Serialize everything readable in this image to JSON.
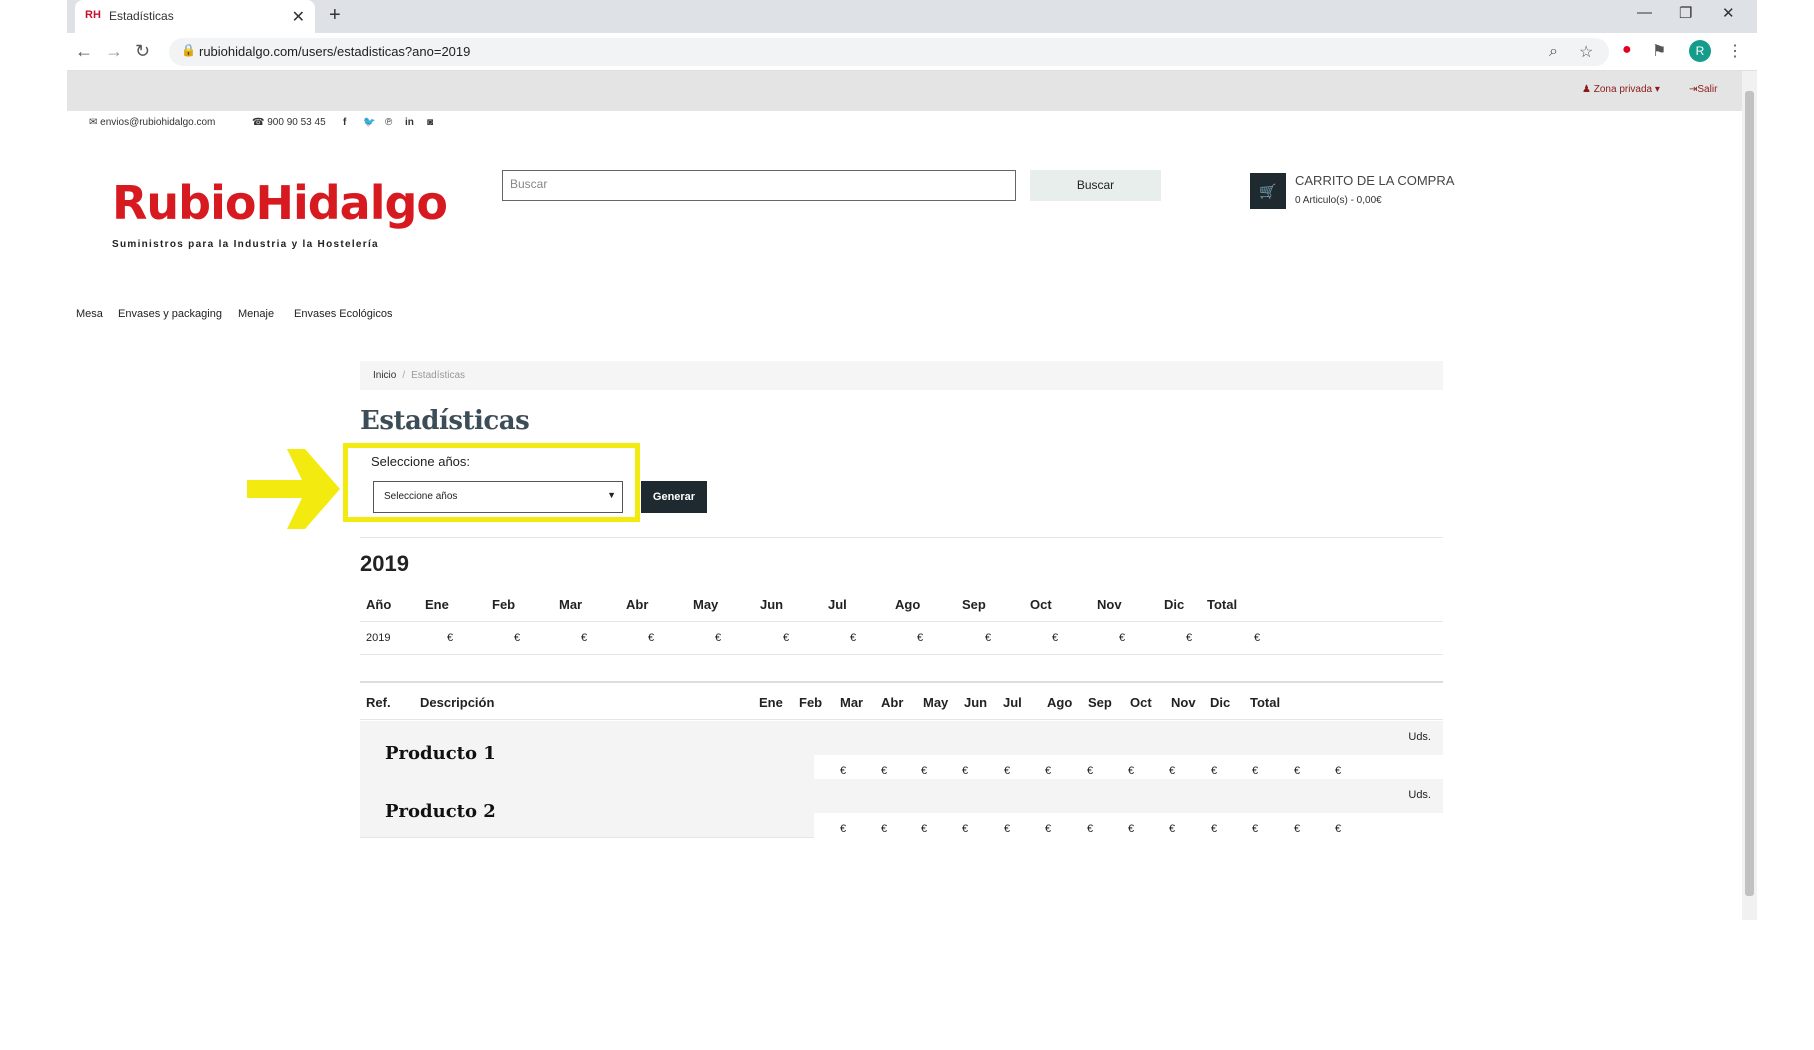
{
  "browser": {
    "tab_badge": "RH",
    "tab_title": "Estadísticas",
    "url": "rubiohidalgo.com/users/estadisticas?ano=2019",
    "avatar_letter": "R"
  },
  "header": {
    "zona_privada": "Zona privada",
    "salir": "Salir",
    "email": "envios@rubiohidalgo.com",
    "phone": "900 90 53 45",
    "logo": "RubioHidalgo",
    "tagline": "Suministros para la Industria y la Hostelería",
    "search_placeholder": "Buscar",
    "search_button": "Buscar",
    "cart_title": "CARRITO DE LA COMPRA",
    "cart_summary": "0 Articulo(s) - 0,00€"
  },
  "nav": [
    "Mesa",
    "Envases y packaging",
    "Menaje",
    "Envases Ecológicos"
  ],
  "breadcrumb": {
    "home": "Inicio",
    "current": "Estadísticas"
  },
  "page_title": "Estadísticas",
  "form": {
    "label": "Seleccione años:",
    "select_value": "Seleccione años",
    "button": "Generar"
  },
  "year_heading": "2019",
  "summary_table": {
    "headers": [
      "Año",
      "Ene",
      "Feb",
      "Mar",
      "Abr",
      "May",
      "Jun",
      "Jul",
      "Ago",
      "Sep",
      "Oct",
      "Nov",
      "Dic",
      "Total"
    ],
    "row": [
      "2019",
      "€",
      "€",
      "€",
      "€",
      "€",
      "€",
      "€",
      "€",
      "€",
      "€",
      "€",
      "€",
      "€"
    ]
  },
  "products_table": {
    "headers": [
      "Ref.",
      "Descripción",
      "Ene",
      "Feb",
      "Mar",
      "Abr",
      "May",
      "Jun",
      "Jul",
      "Ago",
      "Sep",
      "Oct",
      "Nov",
      "Dic",
      "Total"
    ],
    "units_label": "Uds.",
    "rows": [
      {
        "name": "Producto 1",
        "values": [
          "€",
          "€",
          "€",
          "€",
          "€",
          "€",
          "€",
          "€",
          "€",
          "€",
          "€",
          "€",
          "€"
        ]
      },
      {
        "name": "Producto 2",
        "values": [
          "€",
          "€",
          "€",
          "€",
          "€",
          "€",
          "€",
          "€",
          "€",
          "€",
          "€",
          "€",
          "€"
        ]
      }
    ]
  },
  "colors": {
    "brand_red": "#d71920",
    "dark_button": "#1f2a30",
    "highlight_yellow": "#f3ea10"
  }
}
